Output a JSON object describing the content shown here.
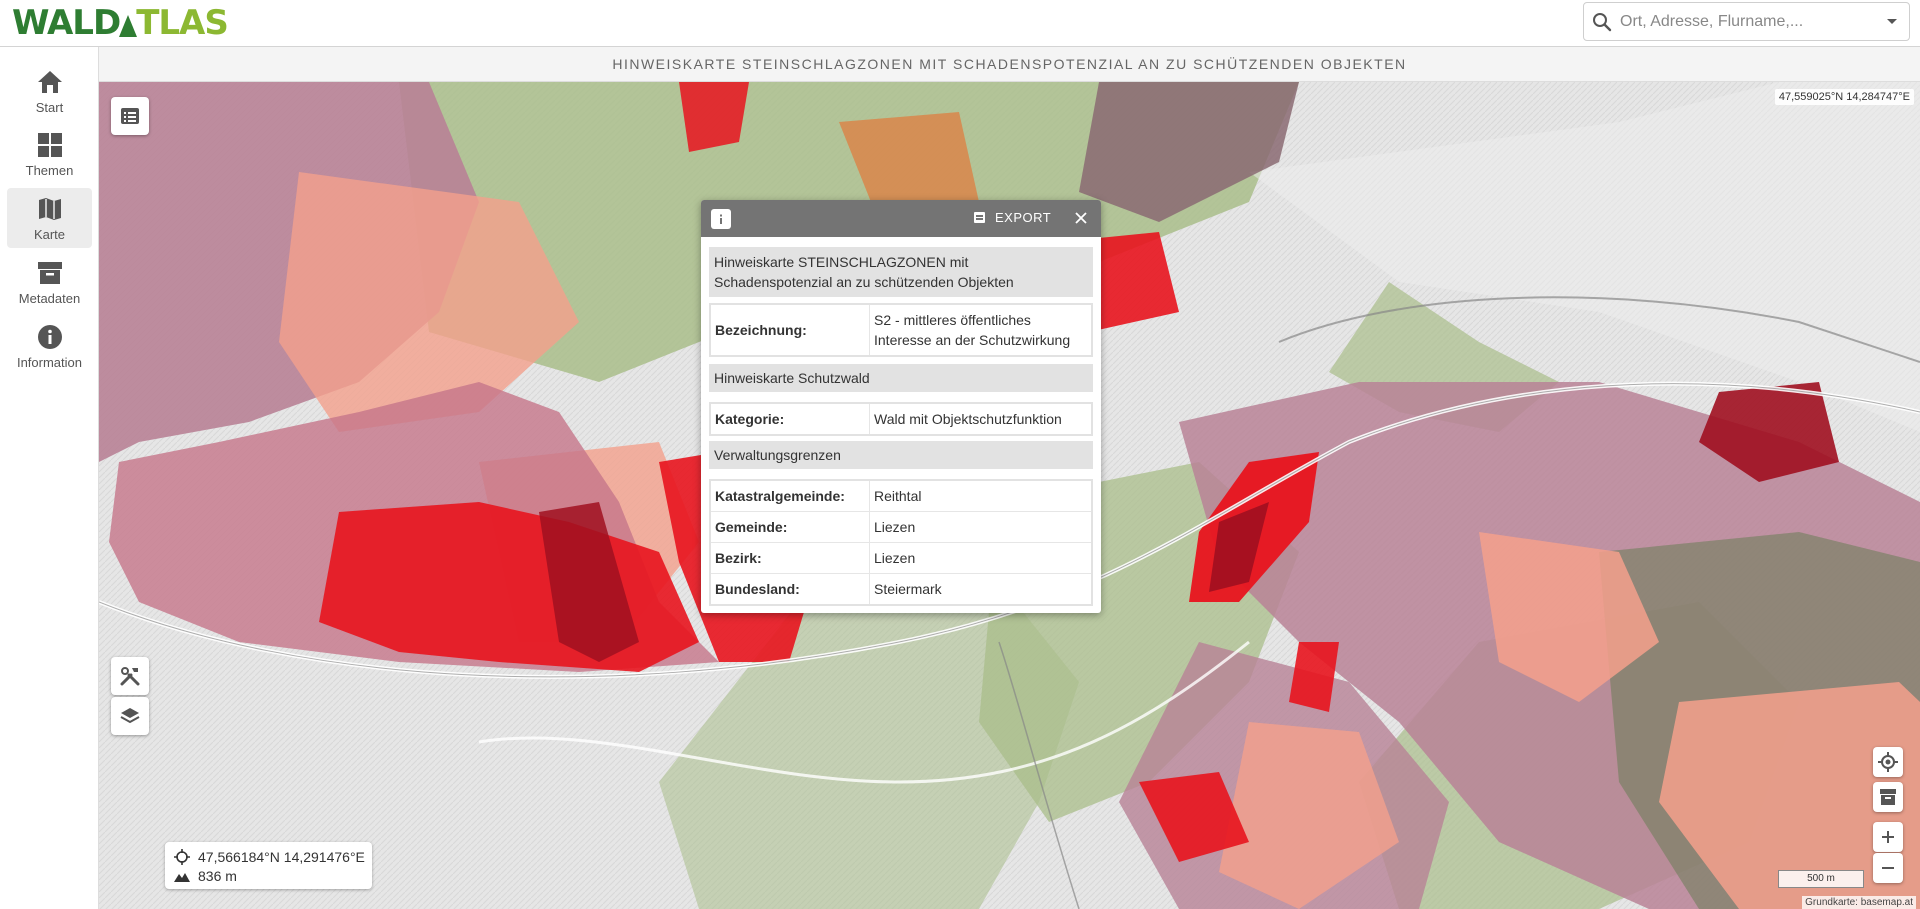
{
  "app": {
    "logo_prefix": "WALD",
    "logo_suffix": "TLAS"
  },
  "search": {
    "placeholder": "Ort, Adresse, Flurname,..."
  },
  "sidebar": {
    "items": [
      {
        "label": "Start",
        "icon": "home-icon"
      },
      {
        "label": "Themen",
        "icon": "grid-icon"
      },
      {
        "label": "Karte",
        "icon": "map-icon",
        "active": true
      },
      {
        "label": "Metadaten",
        "icon": "archive-icon"
      },
      {
        "label": "Information",
        "icon": "info-icon"
      }
    ]
  },
  "title": "HINWEISKARTE STEINSCHLAGZONEN MIT SCHADENSPOTENZIAL AN ZU SCHÜTZENDEN OBJEKTEN",
  "map": {
    "top_coordinate": "47,559025°N 14,284747°E",
    "cursor_coordinate": "47,566184°N 14,291476°E",
    "elevation": "836 m",
    "scale_label": "500 m",
    "attribution": "Grundkarte: basemap.at"
  },
  "popup": {
    "export_label": "EXPORT",
    "sections": [
      {
        "title": "Hinweiskarte STEINSCHLAGZONEN mit Schadenspotenzial an zu schützenden Objekten",
        "rows": [
          {
            "key": "Bezeichnung:",
            "value": "S2 - mittleres öffentliches Interesse an der Schutzwirkung"
          }
        ]
      },
      {
        "title": "Hinweiskarte Schutzwald",
        "rows": [
          {
            "key": "Kategorie:",
            "value": "Wald mit Objektschutzfunktion"
          }
        ]
      },
      {
        "title": "Verwaltungsgrenzen",
        "rows": [
          {
            "key": "Katastralgemeinde:",
            "value": "Reithtal"
          },
          {
            "key": "Gemeinde:",
            "value": "Liezen"
          },
          {
            "key": "Bezirk:",
            "value": "Liezen"
          },
          {
            "key": "Bundesland:",
            "value": "Steiermark"
          }
        ]
      }
    ]
  },
  "colors": {
    "brand_green": "#2e7d32",
    "brand_light_green": "#8cb832",
    "zone_red": "#e8141e",
    "zone_dark_red": "#a01020",
    "zone_salmon": "#f4a08c",
    "zone_mauve": "#b88296",
    "forest_green": "#a9bd8a"
  }
}
